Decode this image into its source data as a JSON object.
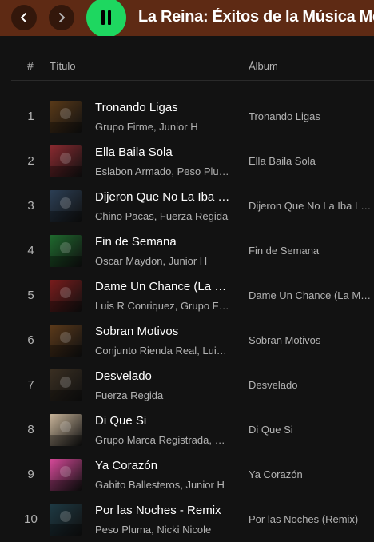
{
  "header": {
    "back_icon": "chevron-left-icon",
    "forward_icon": "chevron-right-icon",
    "play_state_icon": "pause-icon",
    "playlist_title": "La Reina: Éxitos de la Música Mexicana",
    "bar_color": "#5e2a14",
    "play_color": "#1ed760"
  },
  "table": {
    "col_number": "#",
    "col_title": "Título",
    "col_album": "Álbum"
  },
  "tracks": [
    {
      "number": "1",
      "title": "Tronando Ligas",
      "artists": "Grupo Firme, Junior H",
      "album": "Tronando Ligas",
      "cover_color": "#5a3a18"
    },
    {
      "number": "2",
      "title": "Ella Baila Sola",
      "artists": "Eslabon Armado, Peso Pluma",
      "album": "Ella Baila Sola",
      "cover_color": "#8a2a30"
    },
    {
      "number": "3",
      "title": "Dijeron Que No La Iba Lograr",
      "artists": "Chino Pacas, Fuerza Regida",
      "album": "Dijeron Que No La Iba Lograr",
      "cover_color": "#2c3f55"
    },
    {
      "number": "4",
      "title": "Fin de Semana",
      "artists": "Oscar Maydon, Junior H",
      "album": "Fin de Semana",
      "cover_color": "#1f6a2e"
    },
    {
      "number": "5",
      "title": "Dame Un Chance (La Mamalona)",
      "artists": "Luis R Conriquez, Grupo Frontera",
      "album": "Dame Un Chance (La Mamalona)",
      "cover_color": "#7a1c1c"
    },
    {
      "number": "6",
      "title": "Sobran Motivos",
      "artists": "Conjunto Rienda Real, Luis R Conriquez",
      "album": "Sobran Motivos",
      "cover_color": "#5c3a1a"
    },
    {
      "number": "7",
      "title": "Desvelado",
      "artists": "Fuerza Regida",
      "album": "Desvelado",
      "cover_color": "#3a2f22"
    },
    {
      "number": "8",
      "title": "Di Que Si",
      "artists": "Grupo Marca Registrada, Grupo Frontera",
      "album": "Di Que Si",
      "cover_color": "#c9b59a"
    },
    {
      "number": "9",
      "title": "Ya Corazón",
      "artists": "Gabito Ballesteros, Junior H",
      "album": "Ya Corazón",
      "cover_color": "#d8499a"
    },
    {
      "number": "10",
      "title": "Por las Noches - Remix",
      "artists": "Peso Pluma, Nicki Nicole",
      "album": "Por las Noches (Remix)",
      "cover_color": "#1e3a44"
    }
  ]
}
